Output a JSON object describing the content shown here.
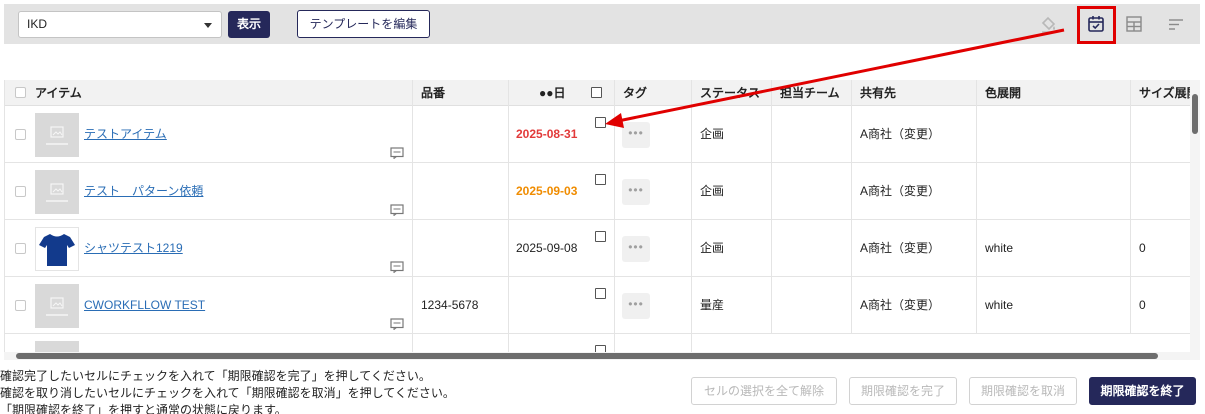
{
  "toolbar": {
    "select_value": "IKD",
    "show_label": "表示",
    "edit_template_label": "テンプレートを編集",
    "icons": [
      "paint-bucket-icon",
      "calendar-check-icon",
      "layout-icon",
      "sort-icon"
    ]
  },
  "grid": {
    "headers": [
      "アイテム",
      "品番",
      "●●日",
      "タグ",
      "ステータス",
      "担当チーム",
      "共有先",
      "色展開",
      "サイズ展開"
    ],
    "rows": [
      {
        "item": "テストアイテム",
        "part_no": "",
        "date": "2025-08-31",
        "date_color": "#e23a3a",
        "status": "企画",
        "team": "",
        "share": "A商社（変更）",
        "color": "",
        "size": "",
        "thumb": "placeholder"
      },
      {
        "item": "テスト　パターン依頼",
        "part_no": "",
        "date": "2025-09-03",
        "date_color": "#f08c00",
        "status": "企画",
        "team": "",
        "share": "A商社（変更）",
        "color": "",
        "size": "",
        "thumb": "placeholder"
      },
      {
        "item": "シャツテスト1219",
        "part_no": "",
        "date": "2025-09-08",
        "date_color": "#222222",
        "status": "企画",
        "team": "",
        "share": "A商社（変更）",
        "color": "white",
        "size": "0",
        "thumb": "tshirt"
      },
      {
        "item": "CWORKFLLOW TEST",
        "part_no": "1234-5678",
        "date": "",
        "date_color": "#222222",
        "status": "量産",
        "team": "",
        "share": "A商社（変更）",
        "color": "white",
        "size": "0",
        "thumb": "placeholder"
      }
    ],
    "tag_button_label": "•••"
  },
  "footer": {
    "hints": [
      "確認完了したいセルにチェックを入れて「期限確認を完了」を押してください。",
      "確認を取り消したいセルにチェックを入れて「期限確認を取消」を押してください。",
      "「期限確認を終了」を押すと通常の状態に戻ります。"
    ],
    "clear_selection_label": "セルの選択を全て解除",
    "complete_label": "期限確認を完了",
    "cancel_label": "期限確認を取消",
    "end_label": "期限確認を終了"
  },
  "colors": {
    "primary": "#25285a",
    "link": "#2a6db5",
    "overdue": "#e23a3a",
    "warning": "#f08c00",
    "highlight": "#e00000"
  }
}
